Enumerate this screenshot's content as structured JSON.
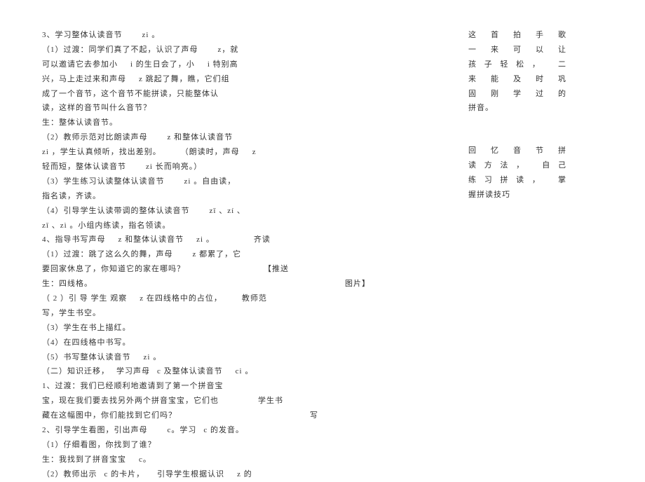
{
  "left": {
    "l1a": "3、学习整体认读音节",
    "l1b": "zi 。",
    "l2a": "（1）过渡：同学们真了不起，认识了声母",
    "l2b": "z，就",
    "l3a": "可以邀请它去参加小",
    "l3b": "i 的生日会了，小",
    "l3c": "i 特别高",
    "l4a": "兴，马上走过来和声母",
    "l4b": "z 跳起了舞，瞧，它们组",
    "l5": "成了一个音节，这个音节不能拼读，只能整体认",
    "l6": "读，这样的音节叫什么音节？",
    "l7": "生：整体认读音节。",
    "l8a": "（2）教师示范对比朗读声母",
    "l8b": "z 和整体认读音节",
    "l9a": "zi ，学生认真倾听，找出差别。",
    "l9b": "（朗读时，声母",
    "l9c": "z",
    "l10a": "轻而短，整体认读音节",
    "l10b": "zi 长而响亮。）",
    "l11a": "（3）学生练习认读整体认读音节",
    "l11b": "zi 。自由读，",
    "l12": "指名读，齐读。",
    "l13a": "（4）引导学生认读带调的整体认读音节",
    "l13b": "zī 、zí 、",
    "l14": "zǐ 、zì 。小组内练读，指名领读。",
    "l15a": "4、指导书写声母",
    "l15b": "z 和整体认读音节",
    "l15c": "zi 。",
    "l16a": "（1）过渡：跳了这么久的舞，声母",
    "l16b": "z 都累了，它",
    "l17": "要回家休息了，你知道它的家在哪吗？",
    "l18": "生：四线格。",
    "l19a": "（ 2 ）引 导 学生 观察",
    "l19b": "z 在四线格中的占位，",
    "l20": "写，学生书空。",
    "l21": "（3）学生在书上描红。",
    "l22": "（4）在四线格中书写。",
    "l23a": "（5）书写整体认读音节",
    "l23b": "zi 。",
    "l24a": "（二）知识迁移，",
    "l24b": "学习声母",
    "l24c": "c 及整体认读音节",
    "l24d": "ci 。",
    "l25": "1、过渡：我们已经顺利地邀请到了第一个拼音宝",
    "l26": "宝，现在我们要去找另外两个拼音宝宝，它们也",
    "l27": "藏在这幅图中，你们能找到它们吗？",
    "l28a": "2、引导学生看图，引出声母",
    "l28b": "c。学习",
    "l28c": "c 的发音。",
    "l29": "（1）仔细看图，你找到了谁？",
    "l30a": "生：我找到了拼音宝宝",
    "l30b": "c。",
    "l31a": "（2）教师出示",
    "l31b": "c 的卡片，",
    "l31c": "引导学生根据认识",
    "l31d": "z 的"
  },
  "mid": {
    "m1": "齐读",
    "m2": "【推送",
    "m3": "图片】",
    "m4": "教师范",
    "m5": "学生书",
    "m6": "写"
  },
  "right": {
    "r1": "这 首 拍 手 歌",
    "r2": "一 来 可 以 让",
    "r3": "孩子轻松，  二",
    "r4": "来 能 及 时 巩",
    "r5": "固 刚 学 过 的",
    "r6": "拼音。",
    "r7": "回 忆 音 节 拼",
    "r8": "读方法，  自己",
    "r9": "练习拼读，  掌",
    "r10": "握拼读技巧"
  }
}
